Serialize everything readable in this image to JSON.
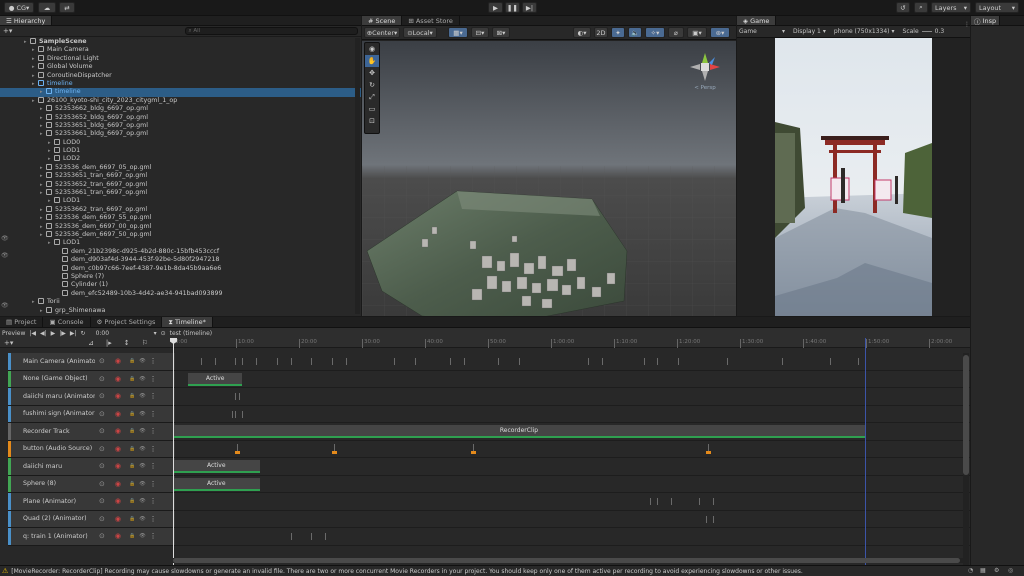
{
  "topbar": {
    "account": "CG",
    "layers": "Layers",
    "layout": "Layout"
  },
  "hierarchy": {
    "tab": "Hierarchy",
    "search_placeholder": "All",
    "items": [
      {
        "label": "SampleScene",
        "indent": 0,
        "bold": true
      },
      {
        "label": "Main Camera",
        "indent": 1
      },
      {
        "label": "Directional Light",
        "indent": 1
      },
      {
        "label": "Global Volume",
        "indent": 1
      },
      {
        "label": "CoroutineDispatcher",
        "indent": 1
      },
      {
        "label": "timeline",
        "indent": 1,
        "blue": true
      },
      {
        "label": "timeline",
        "indent": 2,
        "selected": true,
        "blue": true
      },
      {
        "label": "26100_kyoto-shi_city_2023_citygml_1_op",
        "indent": 1
      },
      {
        "label": "52353662_bldg_6697_op.gml",
        "indent": 2
      },
      {
        "label": "52353652_bldg_6697_op.gml",
        "indent": 2
      },
      {
        "label": "52353651_bldg_6697_op.gml",
        "indent": 2
      },
      {
        "label": "52353661_bldg_6697_op.gml",
        "indent": 2
      },
      {
        "label": "LOD0",
        "indent": 3
      },
      {
        "label": "LOD1",
        "indent": 3
      },
      {
        "label": "LOD2",
        "indent": 3
      },
      {
        "label": "523536_dem_6697_05_op.gml",
        "indent": 2
      },
      {
        "label": "52353651_tran_6697_op.gml",
        "indent": 2
      },
      {
        "label": "52353652_tran_6697_op.gml",
        "indent": 2
      },
      {
        "label": "52353661_tran_6697_op.gml",
        "indent": 2
      },
      {
        "label": "LOD1",
        "indent": 3
      },
      {
        "label": "52353662_tran_6697_op.gml",
        "indent": 2
      },
      {
        "label": "523536_dem_6697_55_op.gml",
        "indent": 2
      },
      {
        "label": "523536_dem_6697_00_op.gml",
        "indent": 2
      },
      {
        "label": "523536_dem_6697_50_op.gml",
        "indent": 2
      },
      {
        "label": "LOD1",
        "indent": 3
      },
      {
        "label": "dem_21b2398c-d925-4b2d-880c-15bfb453cccf",
        "indent": 4
      },
      {
        "label": "dem_d903af4d-3944-453f-92be-5d80f2947218",
        "indent": 4
      },
      {
        "label": "dem_c0b97c66-7eef-4387-9e1b-8da45b9aa6e6",
        "indent": 4
      },
      {
        "label": "Sphere (7)",
        "indent": 4
      },
      {
        "label": "Cylinder (1)",
        "indent": 4
      },
      {
        "label": "dem_efc52489-10b3-4d42-ae34-941bad093899",
        "indent": 4
      },
      {
        "label": "Torii",
        "indent": 1
      },
      {
        "label": "grp_Shimenawa",
        "indent": 2
      }
    ]
  },
  "scene": {
    "tabs": [
      "Scene",
      "Asset Store"
    ],
    "pivot": "Center",
    "space": "Local",
    "mode2d": "2D",
    "gizmo_label": "< Persp"
  },
  "game": {
    "tab": "Game",
    "view": "Game",
    "display": "Display 1",
    "resolution": "phone (750x1334)",
    "scale_label": "Scale",
    "scale_value": "0.3"
  },
  "inspector": {
    "tab": "Insp"
  },
  "bottom_tabs": [
    "Project",
    "Console",
    "Project Settings",
    "Timeline*"
  ],
  "timeline": {
    "preview": "Preview",
    "time": "0:00",
    "asset": "test (timeline)",
    "ruler": [
      "0:00",
      "10:00",
      "20:00",
      "30:00",
      "40:00",
      "50:00",
      "1:00:00",
      "1:10:00",
      "1:20:00",
      "1:30:00",
      "1:40:00",
      "1:50:00",
      "2:00:00",
      "2:10:00",
      "2:20:00"
    ],
    "tracks": [
      {
        "name": "Main Camera (Animator)",
        "color": "#4a90c8",
        "clips": [],
        "keys": [
          0.04,
          0.06,
          0.09,
          0.1,
          0.12,
          0.15,
          0.17,
          0.2,
          0.23,
          0.25,
          0.32,
          0.35,
          0.4,
          0.42,
          0.47,
          0.5,
          0.6,
          0.62,
          0.68,
          0.7,
          0.73,
          0.8,
          0.88,
          0.95,
          0.99,
          1.06
        ]
      },
      {
        "name": "None (Game Object)",
        "color": "#42a654",
        "clips": [
          {
            "label": "Active",
            "start": 0.022,
            "end": 0.1
          }
        ]
      },
      {
        "name": "daiichi maru (Animator)",
        "color": "#4a90c8",
        "clips": [],
        "keys": [
          0.09,
          0.095
        ]
      },
      {
        "name": "fushimi sign (Animator)",
        "color": "#4a90c8",
        "clips": [],
        "keys": [
          0.085,
          0.09,
          0.1
        ]
      },
      {
        "name": "Recorder Track",
        "color": "#666666",
        "clips": [
          {
            "label": "RecorderClip",
            "start": 0.0,
            "end": 1.0
          }
        ]
      },
      {
        "name": "button (Audio Source)",
        "color": "#e48a1b",
        "clips": [],
        "markers": [
          0.09,
          0.23,
          0.43,
          0.77
        ]
      },
      {
        "name": "daiichi maru",
        "color": "#42a654",
        "clips": [
          {
            "label": "Active",
            "start": 0.0,
            "end": 0.125
          }
        ]
      },
      {
        "name": "Sphere (8)",
        "color": "#42a654",
        "clips": [
          {
            "label": "Active",
            "start": 0.0,
            "end": 0.125
          }
        ]
      },
      {
        "name": "Plane (Animator)",
        "color": "#4a90c8",
        "clips": [],
        "keys": [
          0.69,
          0.7,
          0.72,
          0.76,
          0.78
        ]
      },
      {
        "name": "Quad (2) (Animator)",
        "color": "#4a90c8",
        "clips": [],
        "keys": [
          0.77,
          0.78
        ]
      },
      {
        "name": "q: train 1 (Animator)",
        "color": "#4a90c8",
        "clips": [],
        "keys": [
          0.17,
          0.2,
          0.2,
          0.22,
          0.22
        ]
      }
    ]
  },
  "status": {
    "message": "[MovieRecorder: RecorderClip] Recording may cause slowdowns or generate an invalid file. There are two or more concurrent Movie Recorders in your project. You should keep only one of them active per recording to avoid experiencing slowdowns or other issues."
  }
}
